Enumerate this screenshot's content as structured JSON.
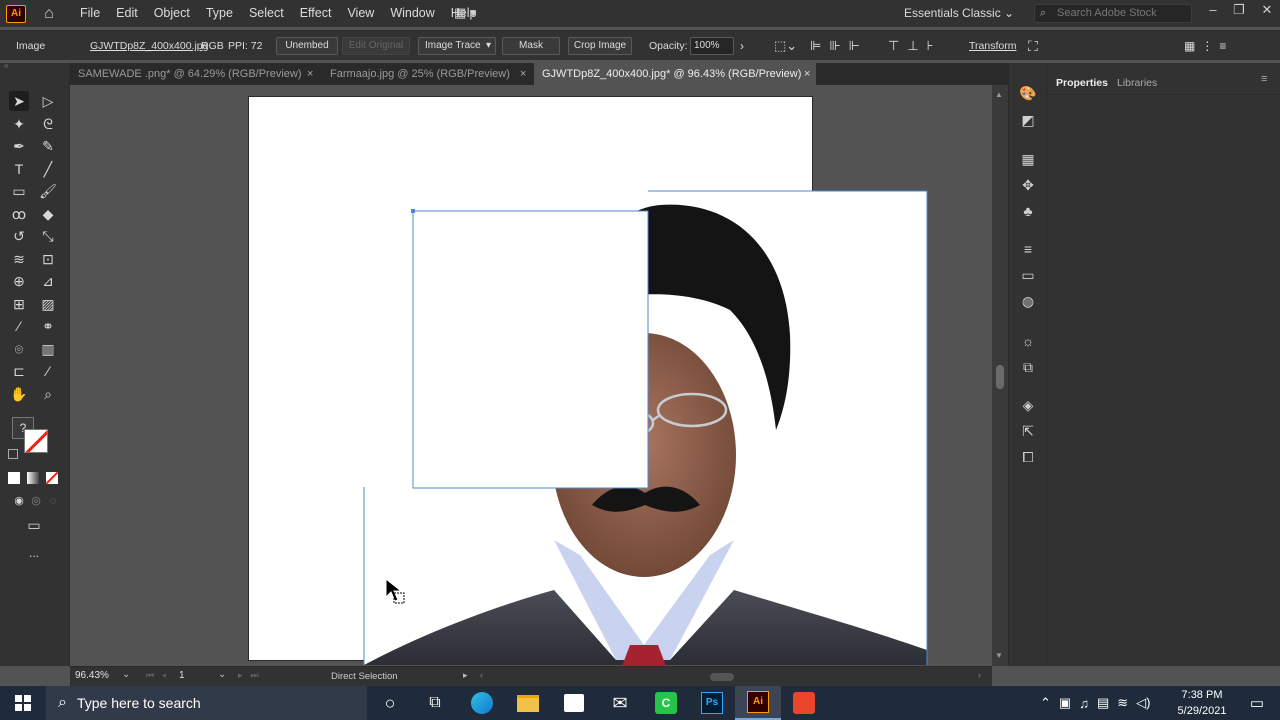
{
  "app": {
    "logo": "Ai",
    "home_icon": "home-icon"
  },
  "menu": [
    "File",
    "Edit",
    "Object",
    "Type",
    "Select",
    "Effect",
    "View",
    "Window",
    "Help"
  ],
  "workspace": "Essentials Classic",
  "search_placeholder": "Search Adobe Stock",
  "control_bar": {
    "selection_type": "Image",
    "file_name": "GJWTDp8Z_400x400.jpg",
    "color_mode": "RGB",
    "ppi": "PPI: 72",
    "unembed": "Unembed",
    "edit_original": "Edit Original",
    "image_trace": "Image Trace",
    "mask": "Mask",
    "crop_image": "Crop Image",
    "opacity_label": "Opacity:",
    "opacity_value": "100%",
    "transform": "Transform"
  },
  "tabs": [
    {
      "label": "SAMEWADE .png* @ 64.29% (RGB/Preview)",
      "close": "×"
    },
    {
      "label": "Farmaajo.jpg @ 25% (RGB/Preview)",
      "close": "×"
    },
    {
      "label": "GJWTDp8Z_400x400.jpg* @ 96.43% (RGB/Preview)",
      "close": "×",
      "active": true
    }
  ],
  "panels": {
    "properties": "Properties",
    "libraries": "Libraries"
  },
  "status": {
    "zoom": "96.43%",
    "artboard": "1",
    "tool": "Direct Selection"
  },
  "fill_stroke": {
    "unknown_fill": "?"
  },
  "more_tools": "...",
  "taskbar": {
    "search_placeholder": "Type here to search",
    "time": "7:38 PM",
    "date": "5/29/2021",
    "photoshop_label": "Ps",
    "illustrator_label": "Ai"
  },
  "colors": {
    "accent": "#ff9a00",
    "selection": "#4a8ad8"
  }
}
